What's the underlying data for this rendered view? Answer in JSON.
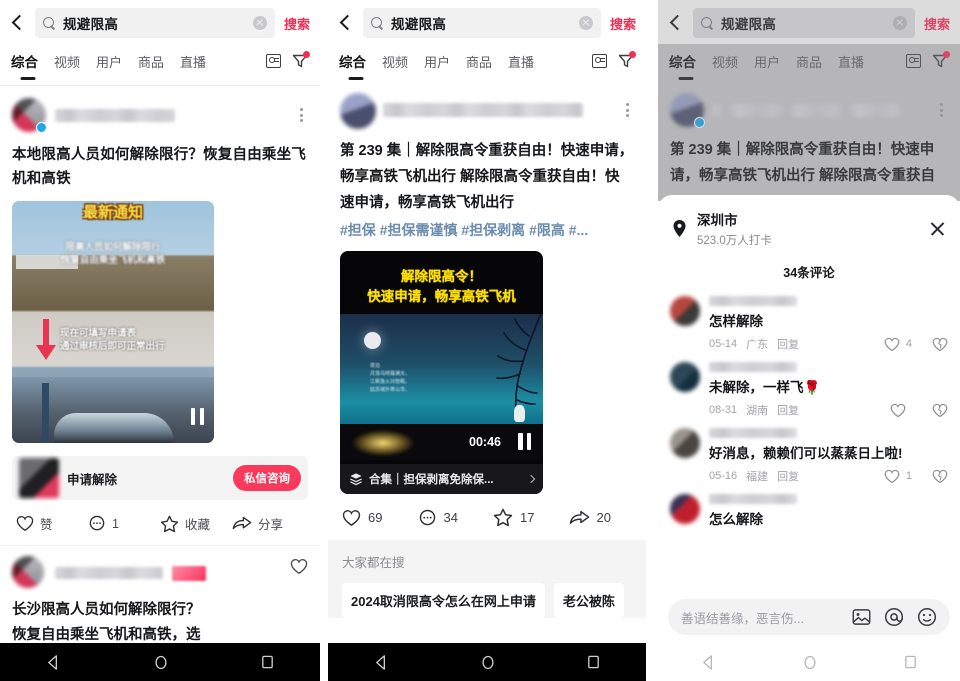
{
  "search": {
    "query": "规避限高",
    "button_label": "搜索",
    "magnifier_icon": "search-icon",
    "clear_icon": "clear-icon",
    "back_icon": "back-chevron-icon"
  },
  "tabs": {
    "items": [
      "综合",
      "视频",
      "用户",
      "商品",
      "直播"
    ],
    "active_index": 0,
    "card_icon": "contact-card-icon",
    "filter_icon": "filter-funnel-icon"
  },
  "panel1": {
    "post": {
      "title": "本地限高人员如何解除限行？恢复自由乘坐飞机和高铁",
      "thumbnail": {
        "top_caption": "最新通知",
        "sub_caption": "限高人员如何解除限行\n恢复自由乘坐飞机和高铁",
        "arrow_caption": "现在可填写申请表\n通过审核后即可正常出行",
        "pause_icon": "pause-icon"
      },
      "ad": {
        "label": "申请解除",
        "button": "私信咨询"
      },
      "engagement": [
        {
          "icon": "heart-icon",
          "label": "赞"
        },
        {
          "icon": "comment-icon",
          "label": "1"
        },
        {
          "icon": "star-icon",
          "label": "收藏"
        },
        {
          "icon": "share-icon",
          "label": "分享"
        }
      ]
    },
    "post2": {
      "title": "长沙限高人员如何解除限行？\n恢复自由乘坐飞机和高铁，选",
      "heart_icon": "heart-icon"
    },
    "navbar": {
      "back": "nav-back-icon",
      "home": "nav-home-icon",
      "recents": "nav-recents-icon"
    }
  },
  "panel2": {
    "post": {
      "text": "第 239 集｜解除限高令重获自由！快速申请，畅享高铁飞机出行 解除限高令重获自由！快速申请，畅享高铁飞机出行",
      "tags": "#担保 #担保需谨慎 #担保剥离 #限高 #...",
      "video": {
        "overlay_title": "解除限高令！\n快速申请，畅享高铁飞机",
        "poem": "夜泊\n月落乌啼霜满天，\n江枫渔火对愁眠。\n姑苏城外寒山寺。",
        "duration": "00:46",
        "pause_icon": "pause-icon",
        "collection_icon": "collection-stack-icon",
        "collection_text": "合集｜担保剥离免除保...",
        "chevron_icon": "chevron-right-icon"
      },
      "engagement": [
        {
          "icon": "heart-icon",
          "label": "69"
        },
        {
          "icon": "comment-icon",
          "label": "34"
        },
        {
          "icon": "star-icon",
          "label": "17"
        },
        {
          "icon": "share-icon",
          "label": "20"
        }
      ]
    },
    "suggest": {
      "title": "大家都在搜",
      "chips": [
        "2024取消限高令怎么在网上申请",
        "老公被陈"
      ]
    },
    "navbar": {
      "back": "nav-back-icon",
      "home": "nav-home-icon",
      "recents": "nav-recents-icon"
    }
  },
  "panel3": {
    "post": {
      "text": "第 239 集｜解除限高令重获自由！快速申请，畅享高铁飞机出行 解除限高令重获自"
    },
    "sheet": {
      "location_icon": "location-pin-icon",
      "location_name": "深圳市",
      "location_sub": "523.0万人打卡",
      "close_icon": "close-icon",
      "comment_count": "34条评论",
      "comments": [
        {
          "text": "怎样解除",
          "date": "05-14",
          "region": "广东",
          "reply": "回复",
          "likes": "4",
          "like_icon": "heart-icon",
          "dislike_icon": "heart-broken-icon"
        },
        {
          "text": "未解除，一样飞🌹",
          "date": "08-31",
          "region": "湖南",
          "reply": "回复",
          "likes": "",
          "like_icon": "heart-icon",
          "dislike_icon": "heart-broken-icon"
        },
        {
          "text": "好消息，赖赖们可以蒸蒸日上啦!",
          "date": "05-16",
          "region": "福建",
          "reply": "回复",
          "likes": "1",
          "like_icon": "heart-icon",
          "dislike_icon": "heart-broken-icon"
        },
        {
          "text": "怎么解除",
          "date": "",
          "region": "",
          "reply": "",
          "likes": "",
          "like_icon": "heart-icon",
          "dislike_icon": "heart-broken-icon"
        }
      ],
      "input_placeholder": "善语结善缘，恶言伤...",
      "image_icon": "image-icon",
      "mention_icon": "at-icon",
      "emoji_icon": "emoji-icon"
    },
    "navbar": {
      "back": "nav-back-icon",
      "home": "nav-home-icon",
      "recents": "nav-recents-icon"
    }
  },
  "colors": {
    "accent_red": "#fa2b52",
    "ad_button": "#fa3a5c",
    "tag_blue": "#6a8caf",
    "video_yellow": "#ffe000"
  }
}
